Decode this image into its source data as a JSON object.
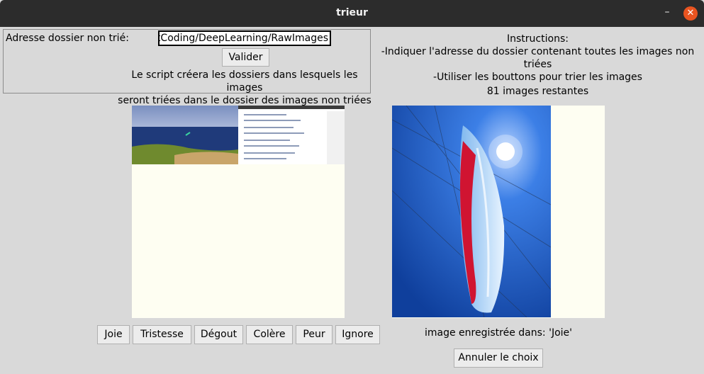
{
  "window": {
    "title": "trieur",
    "minimize_glyph": "–",
    "close_glyph": "✕"
  },
  "config": {
    "folder_label": "Adresse dossier non trié:",
    "folder_value": "ustCoding/DeepLearning/RawImages",
    "validate_label": "Valider",
    "note_line1": "Le script créera les dossiers dans lesquels les images",
    "note_line2": "seront triées dans le dossier des images non triées"
  },
  "instructions": {
    "title": "Instructions:",
    "line1": "-Indiquer l'adresse du dossier contenant toutes les images non triées",
    "line2": "-Utiliser les bouttons pour trier les images",
    "remaining": "81 images restantes"
  },
  "categories": [
    "Joie",
    "Tristesse",
    "Dégout",
    "Colère",
    "Peur",
    "Ignore"
  ],
  "status": {
    "saved_text": "image enregistrée dans: 'Joie'",
    "undo_label": "Annuler le choix"
  },
  "colors": {
    "accent_close": "#e95420",
    "panel_bg": "#fefef2",
    "window_bg": "#d9d9d9"
  }
}
